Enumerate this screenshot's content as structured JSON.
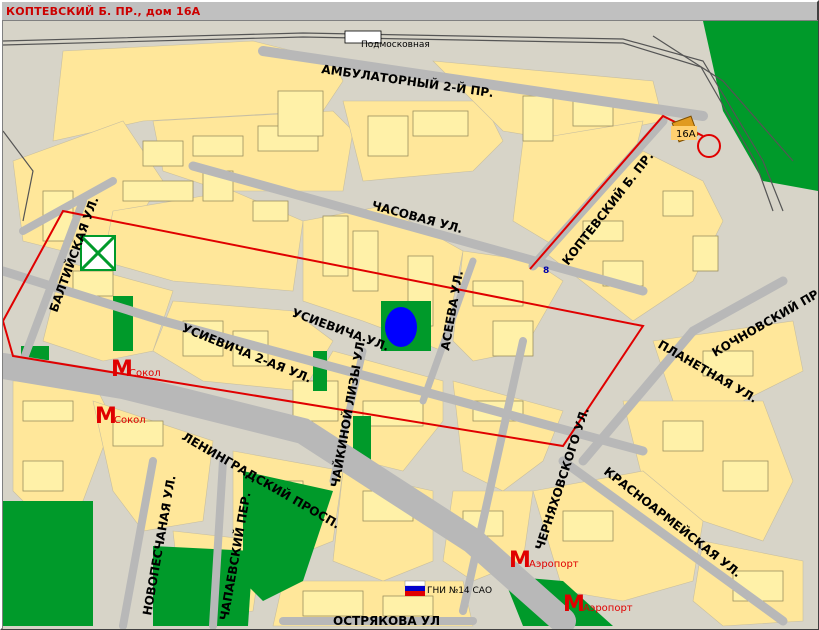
{
  "window": {
    "title": "КОПТЕВСКИЙ Б. ПР., дом 16А"
  },
  "map": {
    "colors": {
      "background": "#d7d4c8",
      "block": "#ffe79a",
      "building": "#ffef9e",
      "park": "#009a2a",
      "water": "#0000ff",
      "route": "#e00000",
      "metro": "#e00000"
    },
    "streets": {
      "ambulatorny": "АМБУЛАТОРНЫЙ 2-Й ПР.",
      "chasovaya": "ЧАСОВАЯ УЛ.",
      "koptevsky": "КОПТЕВСКИЙ Б. ПР.",
      "baltiyskaya": "БАЛТИЙСКАЯ УЛ.",
      "usievicha": "УСИЕВИЧА УЛ.",
      "aseeva": "АСЕЕВА УЛ.",
      "usievicha2": "УСИЕВИЧА 2-АЯ УЛ.",
      "planetnaya": "ПЛАНЕТНАЯ УЛ.",
      "kochnovsky": "КОЧНОВСКИЙ ПР",
      "leningradsky": "ЛЕНИНГРАДСКИЙ ПРОСП.",
      "chaykinoy": "ЧАЙКИНОЙ ЛИЗЫ УЛ.",
      "chernyakhovskogo": "ЧЕРНЯХОВСКОГО УЛ.",
      "krasnoarmeyskaya": "КРАСНОАРМЕЙСКАЯ УЛ.",
      "novopeschanaya": "НОВОПЕСЧАНАЯ УЛ.",
      "chapaevsky": "ЧАПАЕВСКИЙ ПЕР.",
      "ostryakova": "ОСТРЯКОВА УЛ"
    },
    "railway_label": "Подмосковная",
    "house_label": "16А",
    "number_label": "8",
    "metro": [
      {
        "letter": "М",
        "name": "Сокол"
      },
      {
        "letter": "М",
        "name": "Сокол"
      },
      {
        "letter": "М",
        "name": "Аэропорт"
      },
      {
        "letter": "М",
        "name": "Аэропорт"
      }
    ],
    "poi": {
      "name": "ГНИ №14 САО"
    }
  }
}
